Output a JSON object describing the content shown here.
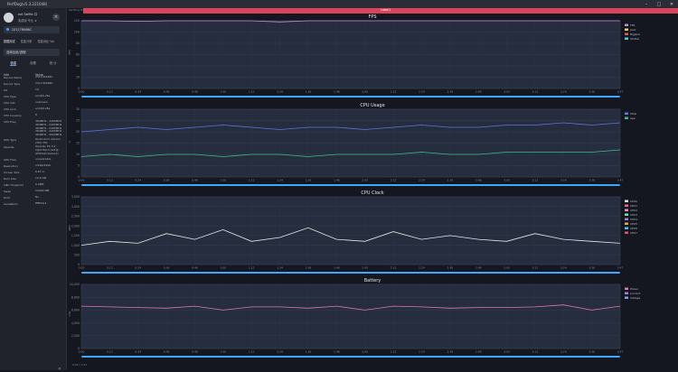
{
  "window": {
    "title": "PerfDog(v5.3.221048)"
  },
  "colors": {
    "accent": "#4a9cff",
    "record_bar": "#d9445a"
  },
  "user": {
    "name": "nel Selfie 口",
    "subtitle": "免费版 专业 ★"
  },
  "device": {
    "name": "23117RK66C"
  },
  "nav_tabs": [
    "数据测试",
    "性能分析",
    "性能对比 Vip"
  ],
  "scene": {
    "label": "选择应用/进程"
  },
  "sub_tabs": [
    "信息",
    "设置",
    "统 计"
  ],
  "info_header": {
    "key": "Info",
    "value": "Value"
  },
  "info": [
    {
      "k": "Device Name",
      "v": "23117RK66C"
    },
    {
      "k": "Device Type",
      "v": "23117RK66C"
    },
    {
      "k": "OS",
      "v": "14"
    },
    {
      "k": "CPU Type",
      "v": "arm64-v8a"
    },
    {
      "k": "CPU Info",
      "v": "unknown"
    },
    {
      "k": "CPU Arch",
      "v": "arm64-v8a"
    },
    {
      "k": "CPU Coreline",
      "v": "8"
    },
    {
      "k": "CPU Freq",
      "v": "384MHz - 2265MHz\n384MHz - 2265MHz\n384MHz - 2265MHz\n384MHz - 2265MHz\n384MHz - 3000MHz"
    },
    {
      "k": "GPU Type",
      "v": "Qualcomm Adreno\n(TM) 750"
    },
    {
      "k": "OpenGL",
      "v": "OpenGL ES 3.2\nV@0760.0 (GIT@\n4f3f2b2c1b2ac2)"
    },
    {
      "k": "GPU Freq",
      "v": "unavailable"
    },
    {
      "k": "Resolution",
      "v": "1440x3200"
    },
    {
      "k": "Screen Size",
      "v": "6.67 in"
    },
    {
      "k": "Ram Size",
      "v": "12.6 GB"
    },
    {
      "k": "LMK Threshold",
      "v": "0.0MB"
    },
    {
      "k": "Swap",
      "v": "10000 MB"
    },
    {
      "k": "Root",
      "v": "No"
    },
    {
      "k": "SerialNum",
      "v": "fffff22c1"
    }
  ],
  "top_strip": {
    "left_label": "PerfDog Pro",
    "center_label": "Label1"
  },
  "time_ticks": [
    "0:00",
    "0:12",
    "0:24",
    "0:36",
    "0:48",
    "1:00",
    "1:12",
    "1:24",
    "1:36",
    "1:48",
    "2:00",
    "2:12",
    "2:24",
    "2:36",
    "2:48",
    "3:00",
    "3:12",
    "3:24",
    "3:36",
    "3:47"
  ],
  "charts": [
    {
      "title": "FPS",
      "ylabel": "FPS",
      "yticks": [
        "120",
        "100",
        "80",
        "60",
        "40",
        "20",
        "0"
      ],
      "legend": [
        "FPS",
        "Jank",
        "BigJank",
        "Stutter"
      ],
      "legend_colors": [
        "#c78be0",
        "#f2d14a",
        "#e05a5a",
        "#4ad0e0"
      ]
    },
    {
      "title": "CPU Usage",
      "ylabel": "%",
      "yticks": [
        "30",
        "25",
        "20",
        "15",
        "10",
        "5",
        "0"
      ],
      "legend": [
        "Total",
        "App"
      ],
      "legend_colors": [
        "#5a78e0",
        "#3ec08a"
      ]
    },
    {
      "title": "CPU Clock",
      "ylabel": "MHz",
      "yticks": [
        "3,500",
        "3,000",
        "2,500",
        "2,000",
        "1,500",
        "1,000",
        "500",
        "0"
      ],
      "legend": [
        "CPU0",
        "CPU1",
        "CPU2",
        "CPU3",
        "CPU4",
        "CPU5",
        "CPU6",
        "CPU7"
      ],
      "legend_colors": [
        "#e8e8e8",
        "#e86a6a",
        "#e890c8",
        "#6ae8a0",
        "#a878e8",
        "#e8a84a",
        "#4ac8e8",
        "#e84a6a"
      ]
    },
    {
      "title": "Battery",
      "ylabel": "mW",
      "yticks": [
        "10,000",
        "8,000",
        "6,000",
        "4,000",
        "2,000",
        "0"
      ],
      "legend": [
        "Power",
        "Current",
        "Voltage"
      ],
      "legend_colors": [
        "#e07aa8",
        "#b878e0",
        "#78a8e0"
      ]
    }
  ],
  "chart_data": [
    {
      "type": "line",
      "title": "FPS",
      "series": [
        {
          "name": "FPS",
          "values": [
            120,
            120,
            119,
            120,
            120,
            120,
            120,
            118,
            120,
            120,
            120,
            120,
            120,
            120,
            120,
            120,
            120,
            120,
            120,
            120
          ]
        }
      ],
      "ylim": [
        0,
        120
      ]
    },
    {
      "type": "line",
      "title": "CPU Usage",
      "series": [
        {
          "name": "Total",
          "values": [
            20,
            21,
            22,
            21,
            22,
            23,
            22,
            21,
            22,
            22,
            21,
            22,
            23,
            22,
            22,
            23,
            23,
            24,
            23,
            24
          ]
        },
        {
          "name": "App",
          "values": [
            9,
            10,
            9,
            10,
            10,
            9,
            10,
            10,
            9,
            10,
            10,
            10,
            11,
            10,
            10,
            11,
            11,
            11,
            11,
            12
          ]
        }
      ],
      "ylim": [
        0,
        30
      ]
    },
    {
      "type": "line",
      "title": "CPU Clock",
      "series": [
        {
          "name": "CPU0",
          "values": [
            1000,
            1200,
            1100,
            1600,
            1300,
            1800,
            1200,
            1400,
            1900,
            1300,
            1200,
            1700,
            1300,
            1500,
            1300,
            1200,
            1600,
            1300,
            1200,
            1100
          ]
        }
      ],
      "ylim": [
        0,
        3500
      ]
    },
    {
      "type": "line",
      "title": "Battery",
      "series": [
        {
          "name": "Power",
          "values": [
            6600,
            6500,
            6400,
            6300,
            6600,
            6000,
            6500,
            6500,
            6300,
            6600,
            6000,
            6600,
            6500,
            6300,
            6400,
            6400,
            6500,
            6800,
            6000,
            6600
          ]
        }
      ],
      "ylim": [
        0,
        10000
      ]
    }
  ],
  "bottom": {
    "label": "0:00 / 3:47"
  }
}
